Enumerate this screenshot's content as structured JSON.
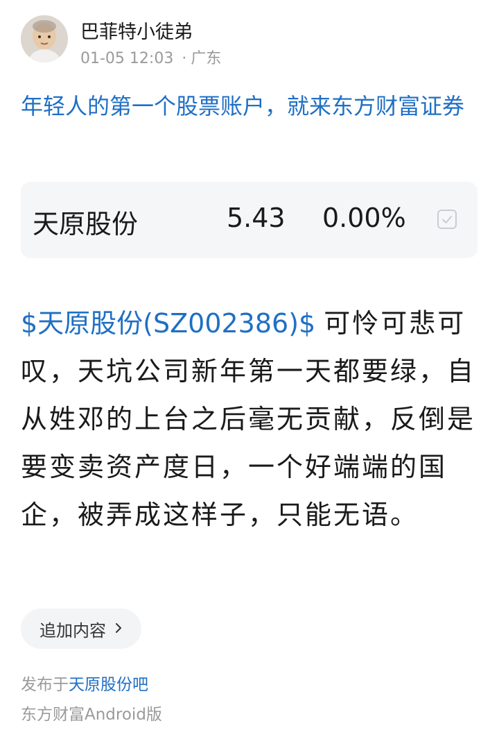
{
  "author": {
    "name": "巴菲特小徒弟",
    "time": "01-05 12:03",
    "separator": "·",
    "location": "广东"
  },
  "promo": {
    "text": "年轻人的第一个股票账户，就来东方财富证券"
  },
  "stock_card": {
    "name": "天原股份",
    "price": "5.43",
    "change": "0.00%"
  },
  "post": {
    "stock_tag": "$天原股份(SZ002386)$",
    "content": "可怜可悲可叹，天坑公司新年第一天都要绿，自从姓邓的上台之后毫无贡献，反倒是要变卖资产度日，一个好端端的国企，被弄成这样子，只能无语。"
  },
  "append_button": {
    "label": "追加内容"
  },
  "footer": {
    "published_prefix": "发布于",
    "bar_name": "天原股份吧",
    "source": "东方财富Android版"
  },
  "colors": {
    "accent": "#1f6fc4",
    "muted": "#9a9a9a",
    "card_bg": "#f5f6f8"
  }
}
